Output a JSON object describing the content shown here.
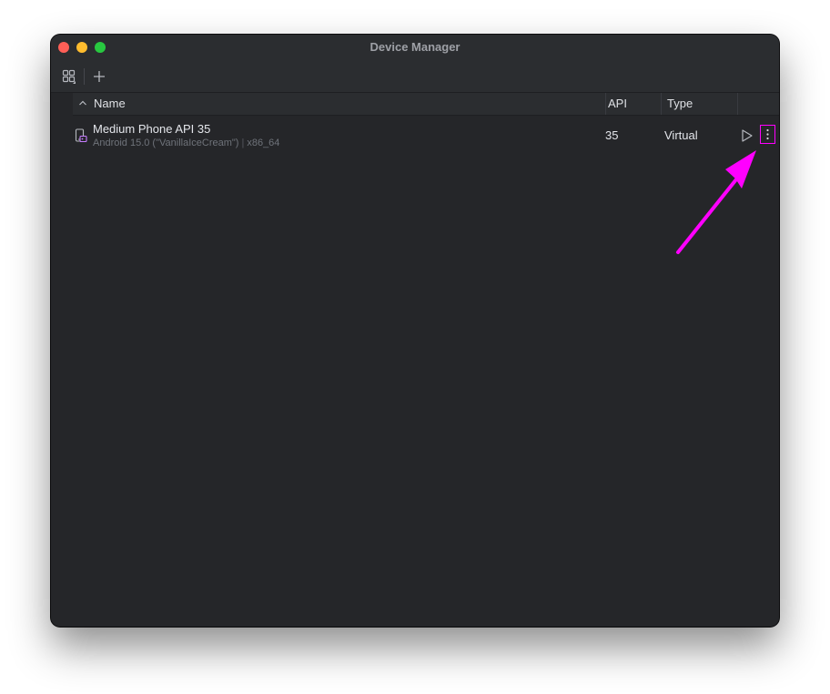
{
  "window": {
    "title": "Device Manager"
  },
  "toolbar": {
    "icons": [
      "device-grid-icon",
      "plus-icon"
    ]
  },
  "table": {
    "columns": {
      "name": "Name",
      "api": "API",
      "type": "Type"
    },
    "sort": "ascending-by-name",
    "rows": [
      {
        "name": "Medium Phone API 35",
        "android": "Android 15.0 (\"VanillaIceCream\")",
        "abi": "x86_64",
        "api": "35",
        "type": "Virtual"
      }
    ]
  },
  "colors": {
    "annotation": "#ff00ff",
    "window_bg": "#252629",
    "text": "#e4e6eb",
    "secondary_text": "#6f737a",
    "close": "#ff5f57",
    "minimize": "#febc2e",
    "zoom": "#28c840"
  }
}
